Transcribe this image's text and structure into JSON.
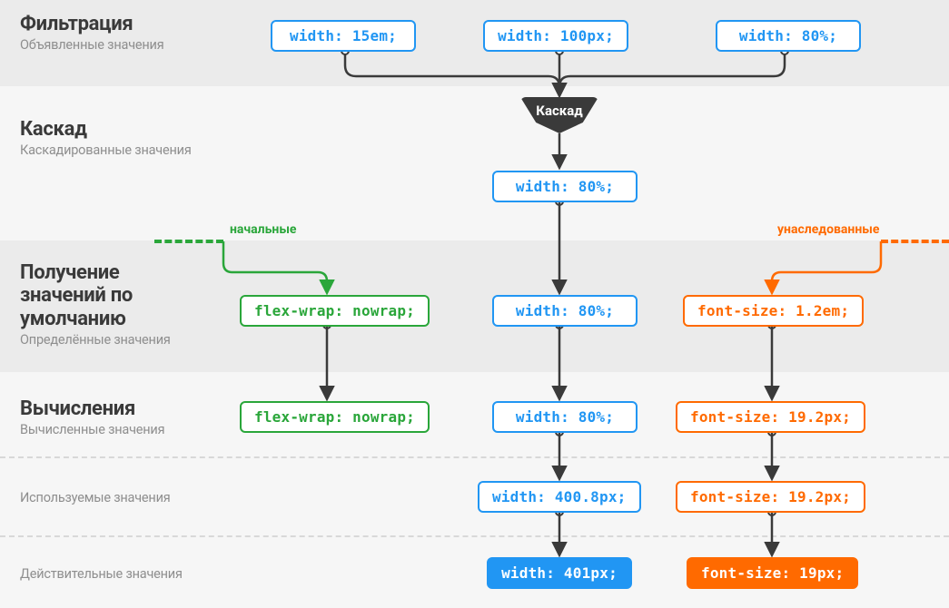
{
  "rows": {
    "filter": {
      "title": "Фильтрация",
      "sub": "Объявленные значения"
    },
    "cascade": {
      "title": "Каскад",
      "sub": "Каскадированные значения"
    },
    "default": {
      "title": "Получение значений по умолчанию",
      "sub": "Определённые значения"
    },
    "compute": {
      "title": "Вычисления",
      "sub": "Вычисленные значения"
    },
    "used": {
      "sub": "Используемые значения"
    },
    "actual": {
      "sub": "Действительные значения"
    }
  },
  "tags": {
    "initial": "начальные",
    "inherited": "унаследованные"
  },
  "funnel": "Каскад",
  "boxes": {
    "filter": {
      "a": "width: 15em;",
      "b": "width: 100px;",
      "c": "width: 80%;"
    },
    "cascade": {
      "mid": "width: 80%;"
    },
    "default": {
      "left": "flex-wrap: nowrap;",
      "mid": "width: 80%;",
      "right": "font-size: 1.2em;"
    },
    "compute": {
      "left": "flex-wrap: nowrap;",
      "mid": "width: 80%;",
      "right": "font-size: 19.2px;"
    },
    "used": {
      "mid": "width: 400.8px;",
      "right": "font-size: 19.2px;"
    },
    "actual": {
      "mid": "width: 401px;",
      "right": "font-size: 19px;"
    }
  },
  "colors": {
    "blue": "#2196f3",
    "green": "#2aa63a",
    "orange": "#ff6a00",
    "dark": "#3a3a3a"
  }
}
